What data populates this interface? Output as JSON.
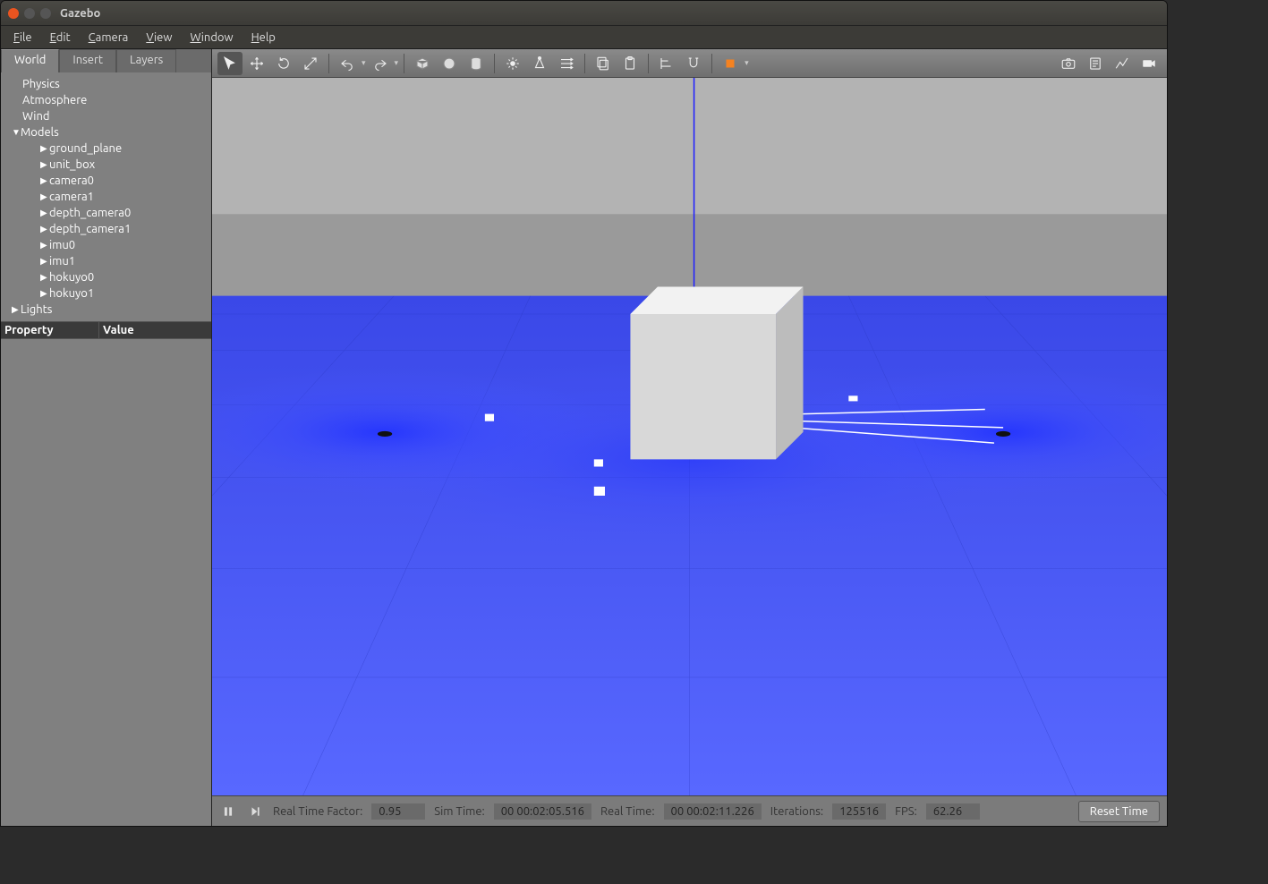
{
  "window": {
    "title": "Gazebo"
  },
  "menubar": [
    "File",
    "Edit",
    "Camera",
    "View",
    "Window",
    "Help"
  ],
  "leftPanel": {
    "tabs": [
      "World",
      "Insert",
      "Layers"
    ],
    "activeTab": 0,
    "tree": {
      "top": [
        "Physics",
        "Atmosphere",
        "Wind"
      ],
      "modelsLabel": "Models",
      "models": [
        "ground_plane",
        "unit_box",
        "camera0",
        "camera1",
        "depth_camera0",
        "depth_camera1",
        "imu0",
        "imu1",
        "hokuyo0",
        "hokuyo1"
      ],
      "lightsLabel": "Lights"
    },
    "propertyHeaders": {
      "col1": "Property",
      "col2": "Value"
    }
  },
  "toolbar": {
    "left": [
      {
        "name": "select-tool",
        "icon": "cursor",
        "active": true
      },
      {
        "name": "translate-tool",
        "icon": "move"
      },
      {
        "name": "rotate-tool",
        "icon": "rotate"
      },
      {
        "name": "scale-tool",
        "icon": "scale"
      }
    ],
    "history": [
      {
        "name": "undo-button",
        "icon": "undo"
      },
      {
        "name": "redo-button",
        "icon": "redo"
      }
    ],
    "shapes": [
      {
        "name": "box-tool",
        "icon": "box"
      },
      {
        "name": "sphere-tool",
        "icon": "sphere"
      },
      {
        "name": "cylinder-tool",
        "icon": "cylinder"
      }
    ],
    "lights": [
      {
        "name": "point-light-tool",
        "icon": "pointlight"
      },
      {
        "name": "spot-light-tool",
        "icon": "spotlight"
      },
      {
        "name": "directional-light-tool",
        "icon": "dirlight"
      }
    ],
    "clipboard": [
      {
        "name": "copy-button",
        "icon": "copy"
      },
      {
        "name": "paste-button",
        "icon": "paste"
      }
    ],
    "align": [
      {
        "name": "align-tool",
        "icon": "align"
      },
      {
        "name": "snap-tool",
        "icon": "snap"
      }
    ],
    "view": [
      {
        "name": "view-angle-tool",
        "icon": "viewangle"
      }
    ],
    "right": [
      {
        "name": "screenshot-button",
        "icon": "camera"
      },
      {
        "name": "log-button",
        "icon": "log"
      },
      {
        "name": "plot-button",
        "icon": "plot"
      },
      {
        "name": "record-button",
        "icon": "record"
      }
    ]
  },
  "status": {
    "rtfLabel": "Real Time Factor:",
    "rtf": "0.95",
    "simTimeLabel": "Sim Time:",
    "simTime": "00 00:02:05.516",
    "realTimeLabel": "Real Time:",
    "realTime": "00 00:02:11.226",
    "iterLabel": "Iterations:",
    "iter": "125516",
    "fpsLabel": "FPS:",
    "fps": "62.26",
    "reset": "Reset Time"
  }
}
